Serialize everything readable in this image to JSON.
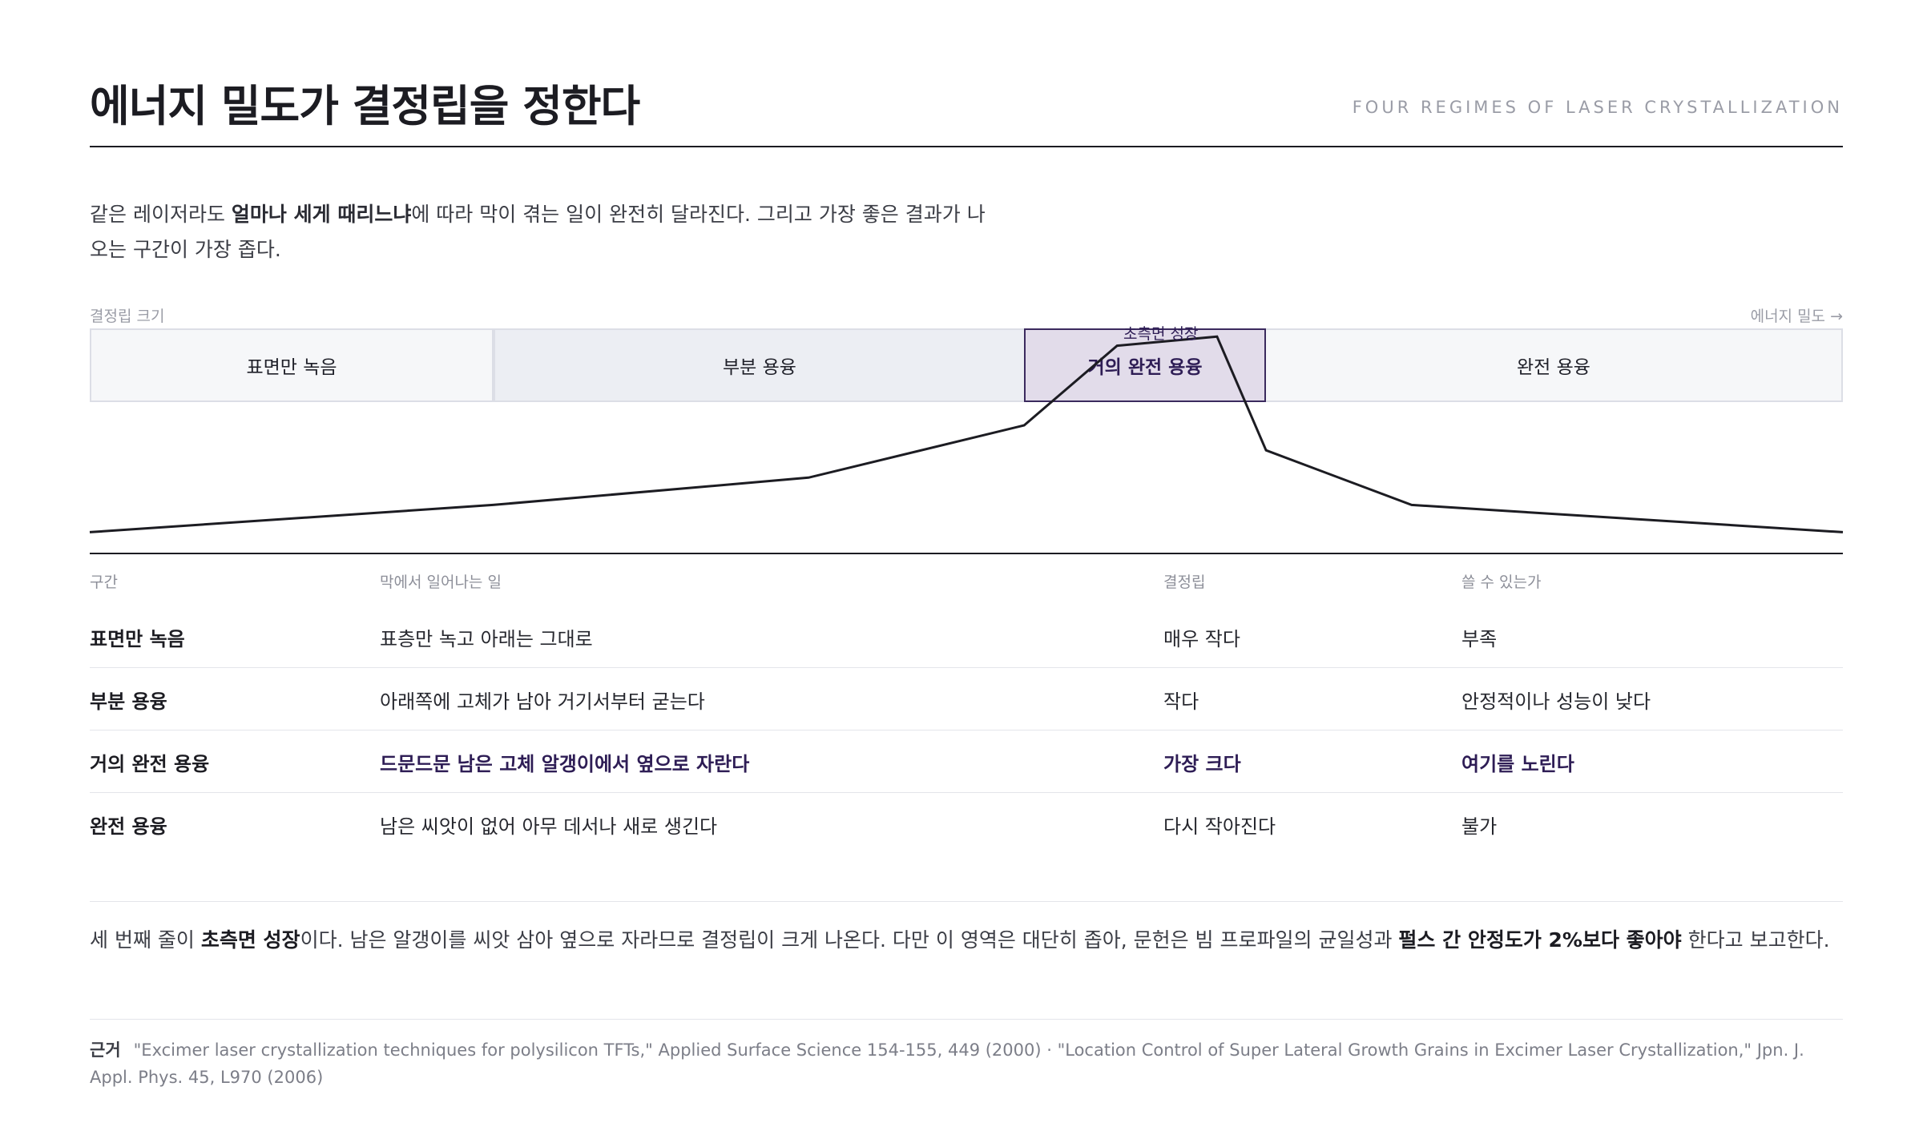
{
  "header": {
    "title": "에너지 밀도가 결정립을 정한다",
    "subtitle": "FOUR REGIMES OF LASER CRYSTALLIZATION"
  },
  "intro": {
    "part1": "같은 레이저라도 ",
    "strong": "얼마나 세게 때리느냐",
    "part2": "에 따라 막이 겪는 일이 완전히 달라진다. 그리고 가장 좋은 결과가 나오는 구간이 가장 좁다."
  },
  "chart_data": {
    "type": "line",
    "ylabel": "결정립 크기",
    "xlabel": "에너지 밀도 →",
    "regimes": [
      "표면만 녹음",
      "부분 용융",
      "거의 완전 용융",
      "완전 용융"
    ],
    "highlight_regime": "거의 완전 용융",
    "annotation": "초측면 성장",
    "x": [
      0,
      0.23,
      0.41,
      0.533,
      0.586,
      0.643,
      0.671,
      0.754,
      1
    ],
    "y": [
      0.09,
      0.21,
      0.33,
      0.56,
      0.91,
      0.95,
      0.45,
      0.21,
      0.09
    ]
  },
  "table": {
    "headers": [
      "구간",
      "막에서 일어나는 일",
      "결정립",
      "쓸 수 있는가"
    ],
    "rows": [
      [
        "표면만 녹음",
        "표층만 녹고 아래는 그대로",
        "매우 작다",
        "부족"
      ],
      [
        "부분 용융",
        "아래쪽에 고체가 남아 거기서부터 굳는다",
        "작다",
        "안정적이나 성능이 낮다"
      ],
      [
        "거의 완전 용융",
        "드문드문 남은 고체 알갱이에서 옆으로 자란다",
        "가장 크다",
        "여기를 노린다"
      ],
      [
        "완전 용융",
        "남은 씨앗이 없어 아무 데서나 새로 생긴다",
        "다시 작아진다",
        "불가"
      ]
    ]
  },
  "summary": {
    "part1": "세 번째 줄이 ",
    "strong1": "초측면 성장",
    "part2": "이다. 남은 알갱이를 씨앗 삼아 옆으로 자라므로 결정립이 크게 나온다. 다만 이 영역은 대단히 좁아, 문헌은 빔 프로파일의 균일성과 ",
    "strong2": "펄스 간 안정도가 2%보다 좋아야",
    "part3": " 한다고 보고한다."
  },
  "refs": {
    "label": "근거",
    "text": "\"Excimer laser crystallization techniques for polysilicon TFTs,\" Applied Surface Science 154-155, 449 (2000) · \"Location Control of Super Lateral Growth Grains in Excimer Laser Crystallization,\" Jpn. J. Appl. Phys. 45, L970 (2006)"
  },
  "colors": {
    "accent": "#2e1d55",
    "highlight_fill": "#e2dcea",
    "line": "#1c1c22"
  }
}
